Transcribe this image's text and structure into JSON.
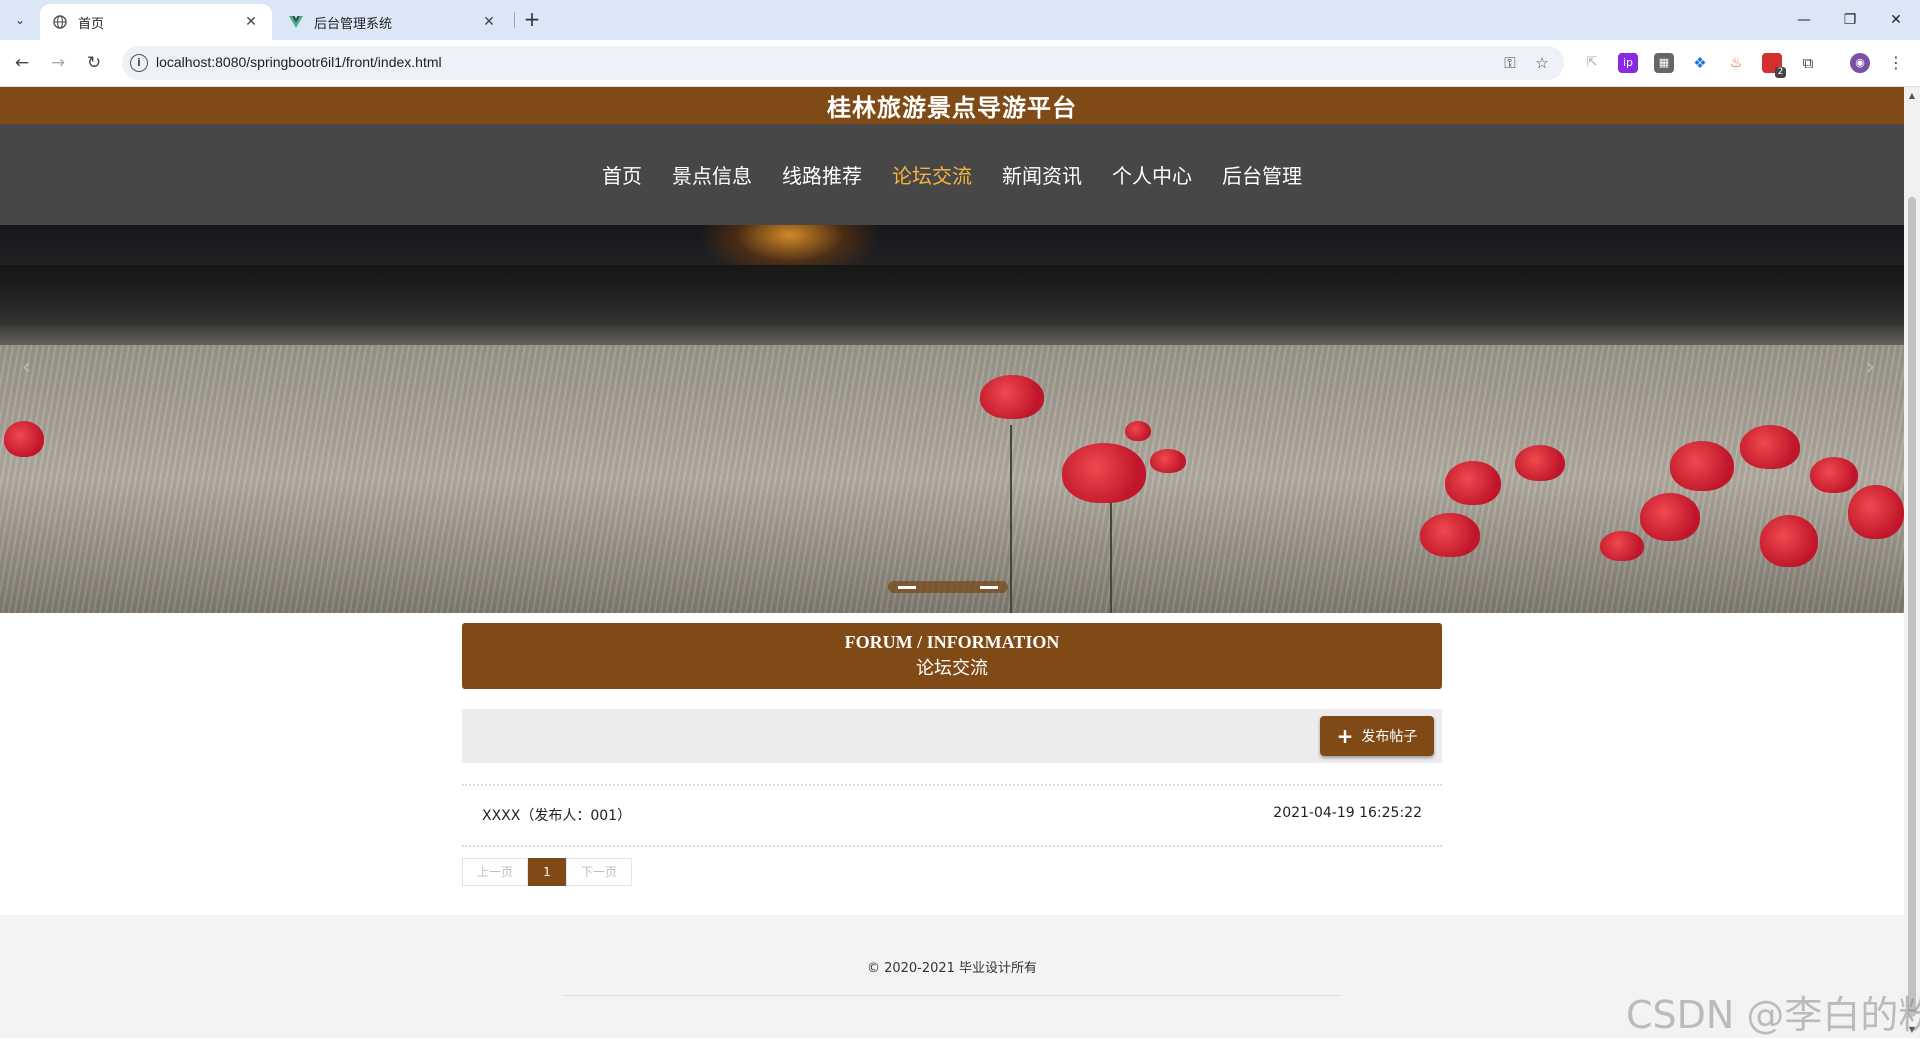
{
  "browser": {
    "tabs": [
      {
        "title": "首页",
        "icon": "globe-icon",
        "active": true
      },
      {
        "title": "后台管理系统",
        "icon": "vue-logo-icon",
        "active": false
      }
    ],
    "url": "localhost:8080/springbootr6il1/front/index.html",
    "extension_badge": "2"
  },
  "site": {
    "title": "桂林旅游景点导游平台",
    "accent_color": "#7f4a16",
    "nav": [
      {
        "label": "首页",
        "active": false
      },
      {
        "label": "景点信息",
        "active": false
      },
      {
        "label": "线路推荐",
        "active": false
      },
      {
        "label": "论坛交流",
        "active": true
      },
      {
        "label": "新闻资讯",
        "active": false
      },
      {
        "label": "个人中心",
        "active": false
      },
      {
        "label": "后台管理",
        "active": false
      }
    ]
  },
  "section": {
    "title_en": "FORUM / INFORMATION",
    "title_cn": "论坛交流"
  },
  "toolbar": {
    "post_button": "发布帖子"
  },
  "posts": [
    {
      "title": "XXXX（发布人：001）",
      "time": "2021-04-19 16:25:22"
    }
  ],
  "pagination": {
    "prev": "上一页",
    "current": "1",
    "next": "下一页"
  },
  "footer": {
    "copyright": "© 2020-2021 毕业设计所有"
  },
  "watermark": "CSDN @李白的粉"
}
